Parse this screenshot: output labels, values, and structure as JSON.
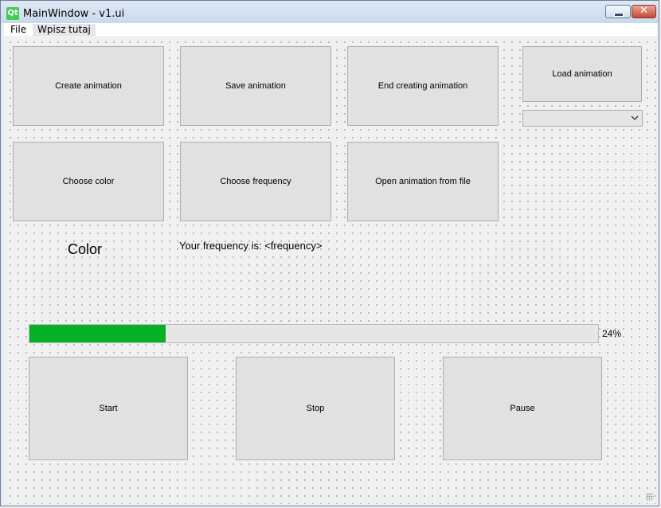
{
  "window": {
    "title": "MainWindow - v1.ui",
    "logo_text": "Qt",
    "minimize_glyph": "",
    "close_glyph": "✕"
  },
  "menubar": {
    "items": [
      {
        "label": "File"
      },
      {
        "label": "Wpisz tutaj"
      }
    ]
  },
  "buttons": {
    "create_animation": "Create animation",
    "save_animation": "Save animation",
    "end_creating_animation": "End creating animation",
    "load_animation": "Load animation",
    "choose_color": "Choose color",
    "choose_frequency": "Choose frequency",
    "open_animation_from_file": "Open animation from file",
    "start": "Start",
    "stop": "Stop",
    "pause": "Pause"
  },
  "combo": {
    "selected_value": ""
  },
  "labels": {
    "color": "Color",
    "frequency": "Your frequency is:  <frequency>"
  },
  "progress": {
    "value_percent": 24,
    "text": "24%",
    "fill_color": "#06b025"
  },
  "icons": {
    "logo": "qt-logo-icon",
    "combo_arrow": "chevron-down-icon",
    "resize_grip": "size-grip-icon"
  }
}
